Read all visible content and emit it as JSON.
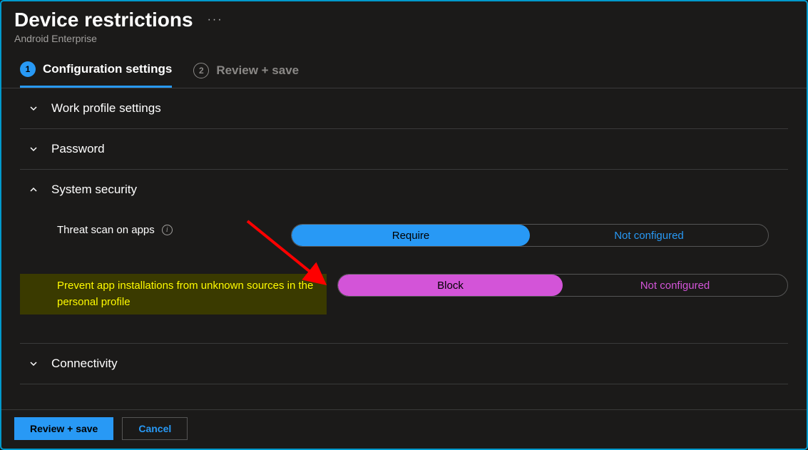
{
  "header": {
    "title": "Device restrictions",
    "more": "···",
    "subtitle": "Android Enterprise"
  },
  "tabs": [
    {
      "number": "1",
      "label": "Configuration settings",
      "active": true
    },
    {
      "number": "2",
      "label": "Review + save",
      "active": false
    }
  ],
  "sections": {
    "workProfile": {
      "title": "Work profile settings",
      "expanded": false
    },
    "password": {
      "title": "Password",
      "expanded": false
    },
    "systemSecurity": {
      "title": "System security",
      "expanded": true
    },
    "connectivity": {
      "title": "Connectivity",
      "expanded": false
    }
  },
  "settings": {
    "threatScan": {
      "label": "Threat scan on apps",
      "option1": "Require",
      "option2": "Not configured",
      "selected": 1,
      "color": "blue"
    },
    "preventInstall": {
      "label": "Prevent app installations from unknown sources in the personal profile",
      "option1": "Block",
      "option2": "Not configured",
      "selected": 1,
      "color": "magenta",
      "highlighted": true
    }
  },
  "footer": {
    "primary": "Review + save",
    "secondary": "Cancel"
  },
  "colors": {
    "accent": "#2899f5",
    "highlight": "#d354d8",
    "highlightBg": "#3a3a00",
    "highlightText": "#fffb00",
    "arrow": "#ff0000"
  }
}
